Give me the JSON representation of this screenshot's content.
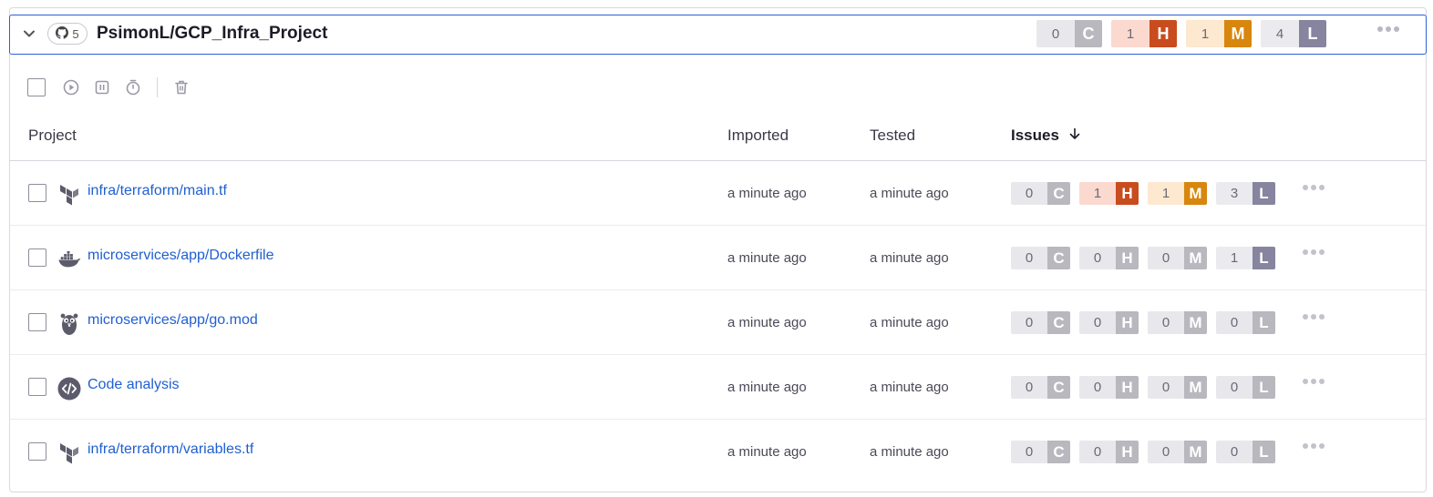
{
  "header": {
    "repo_count": "5",
    "title": "PsimonL/GCP_Infra_Project",
    "severity": [
      {
        "value": "0",
        "letter": "C",
        "bg": "#e8e8ec",
        "text": "#6a6a78",
        "letter_bg": "#b8b8be"
      },
      {
        "value": "1",
        "letter": "H",
        "bg": "#fbd9cf",
        "text": "#6a6a78",
        "letter_bg": "#c94c1f"
      },
      {
        "value": "1",
        "letter": "M",
        "bg": "#fde8d0",
        "text": "#6a6a78",
        "letter_bg": "#d8860d"
      },
      {
        "value": "4",
        "letter": "L",
        "bg": "#ebebef",
        "text": "#6a6a78",
        "letter_bg": "#86849e"
      }
    ]
  },
  "columns": {
    "project": "Project",
    "imported": "Imported",
    "tested": "Tested",
    "issues": "Issues"
  },
  "rows": [
    {
      "name": "infra/terraform/main.tf",
      "icon": "terraform-icon",
      "imported": "a minute ago",
      "tested": "a minute ago",
      "severity": [
        {
          "value": "0",
          "letter": "C",
          "bg": "#e8e8ec",
          "text": "#6a6a78",
          "letter_bg": "#b8b8be"
        },
        {
          "value": "1",
          "letter": "H",
          "bg": "#fbd9cf",
          "text": "#6a6a78",
          "letter_bg": "#c94c1f"
        },
        {
          "value": "1",
          "letter": "M",
          "bg": "#fde8d0",
          "text": "#6a6a78",
          "letter_bg": "#d8860d"
        },
        {
          "value": "3",
          "letter": "L",
          "bg": "#ebebef",
          "text": "#6a6a78",
          "letter_bg": "#86849e"
        }
      ]
    },
    {
      "name": "microservices/app/Dockerfile",
      "icon": "docker-icon",
      "imported": "a minute ago",
      "tested": "a minute ago",
      "severity": [
        {
          "value": "0",
          "letter": "C",
          "bg": "#e8e8ec",
          "text": "#6a6a78",
          "letter_bg": "#b8b8be"
        },
        {
          "value": "0",
          "letter": "H",
          "bg": "#e8e8ec",
          "text": "#6a6a78",
          "letter_bg": "#b8b8be"
        },
        {
          "value": "0",
          "letter": "M",
          "bg": "#e8e8ec",
          "text": "#6a6a78",
          "letter_bg": "#b8b8be"
        },
        {
          "value": "1",
          "letter": "L",
          "bg": "#ebebef",
          "text": "#6a6a78",
          "letter_bg": "#86849e"
        }
      ]
    },
    {
      "name": "microservices/app/go.mod",
      "icon": "gopher-icon",
      "imported": "a minute ago",
      "tested": "a minute ago",
      "severity": [
        {
          "value": "0",
          "letter": "C",
          "bg": "#e8e8ec",
          "text": "#6a6a78",
          "letter_bg": "#b8b8be"
        },
        {
          "value": "0",
          "letter": "H",
          "bg": "#e8e8ec",
          "text": "#6a6a78",
          "letter_bg": "#b8b8be"
        },
        {
          "value": "0",
          "letter": "M",
          "bg": "#e8e8ec",
          "text": "#6a6a78",
          "letter_bg": "#b8b8be"
        },
        {
          "value": "0",
          "letter": "L",
          "bg": "#e8e8ec",
          "text": "#6a6a78",
          "letter_bg": "#b8b8be"
        }
      ]
    },
    {
      "name": "Code analysis",
      "icon": "code-icon",
      "imported": "a minute ago",
      "tested": "a minute ago",
      "severity": [
        {
          "value": "0",
          "letter": "C",
          "bg": "#e8e8ec",
          "text": "#6a6a78",
          "letter_bg": "#b8b8be"
        },
        {
          "value": "0",
          "letter": "H",
          "bg": "#e8e8ec",
          "text": "#6a6a78",
          "letter_bg": "#b8b8be"
        },
        {
          "value": "0",
          "letter": "M",
          "bg": "#e8e8ec",
          "text": "#6a6a78",
          "letter_bg": "#b8b8be"
        },
        {
          "value": "0",
          "letter": "L",
          "bg": "#e8e8ec",
          "text": "#6a6a78",
          "letter_bg": "#b8b8be"
        }
      ]
    },
    {
      "name": "infra/terraform/variables.tf",
      "icon": "terraform-icon",
      "imported": "a minute ago",
      "tested": "a minute ago",
      "severity": [
        {
          "value": "0",
          "letter": "C",
          "bg": "#e8e8ec",
          "text": "#6a6a78",
          "letter_bg": "#b8b8be"
        },
        {
          "value": "0",
          "letter": "H",
          "bg": "#e8e8ec",
          "text": "#6a6a78",
          "letter_bg": "#b8b8be"
        },
        {
          "value": "0",
          "letter": "M",
          "bg": "#e8e8ec",
          "text": "#6a6a78",
          "letter_bg": "#b8b8be"
        },
        {
          "value": "0",
          "letter": "L",
          "bg": "#e8e8ec",
          "text": "#6a6a78",
          "letter_bg": "#b8b8be"
        }
      ]
    }
  ]
}
